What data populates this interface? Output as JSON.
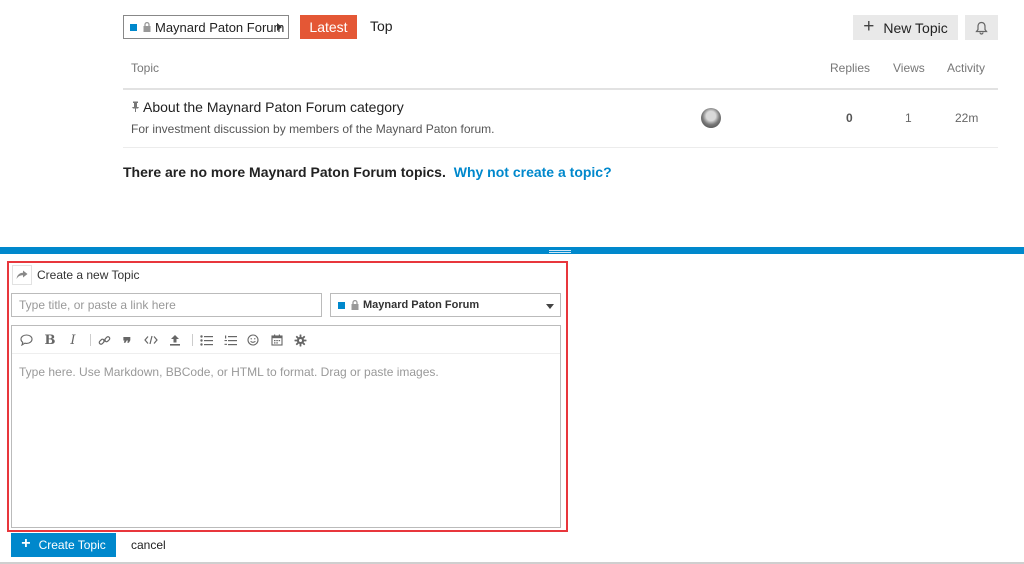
{
  "nav": {
    "category_dropdown": "Maynard Paton Forum",
    "tabs": [
      {
        "label": "Latest",
        "active": true
      },
      {
        "label": "Top",
        "active": false
      }
    ],
    "new_topic_label": "New Topic"
  },
  "colors": {
    "category": "#0088cc",
    "latest_tab": "#e45735",
    "primary": "#0088cc",
    "highlight_border": "#e8363c"
  },
  "table": {
    "headers": {
      "topic": "Topic",
      "replies": "Replies",
      "views": "Views",
      "activity": "Activity"
    },
    "rows": [
      {
        "pinned": true,
        "title": "About the Maynard Paton Forum category",
        "excerpt": "For investment discussion by members of the Maynard Paton forum.",
        "replies": "0",
        "views": "1",
        "activity": "22m"
      }
    ]
  },
  "footer": {
    "message": "There are no more Maynard Paton Forum topics.",
    "link": "Why not create a topic?"
  },
  "composer": {
    "action_title": "Create a new Topic",
    "title_placeholder": "Type title, or paste a link here",
    "category": "Maynard Paton Forum",
    "toolbar": [
      "quote-icon",
      "bold-icon",
      "italic-icon",
      "link-icon",
      "blockquote-icon",
      "code-icon",
      "upload-icon",
      "bullet-list-icon",
      "numbered-list-icon",
      "emoji-icon",
      "calendar-icon",
      "gear-icon"
    ],
    "body_placeholder": "Type here. Use Markdown, BBCode, or HTML to format. Drag or paste images.",
    "submit_label": "Create Topic",
    "cancel_label": "cancel"
  }
}
